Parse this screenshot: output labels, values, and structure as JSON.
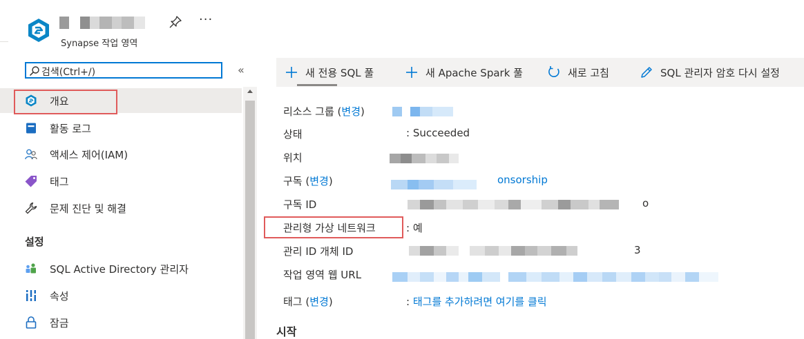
{
  "header": {
    "subtitle": "Synapse 작업 영역",
    "more_label": "···"
  },
  "search": {
    "placeholder": "검색(Ctrl+/)",
    "collapse_label": "«"
  },
  "sidebar": {
    "items": [
      {
        "label": "개요",
        "icon": "synapse-overview-icon"
      },
      {
        "label": "활동 로그",
        "icon": "activity-log-icon"
      },
      {
        "label": "액세스 제어(IAM)",
        "icon": "people-icon"
      },
      {
        "label": "태그",
        "icon": "tag-icon"
      },
      {
        "label": "문제 진단 및 해결",
        "icon": "wrench-icon"
      }
    ],
    "settings_section": "설정",
    "settings_items": [
      {
        "label": "SQL Active Directory 관리자",
        "icon": "sql-ad-admin-icon"
      },
      {
        "label": "속성",
        "icon": "properties-icon"
      },
      {
        "label": "잠금",
        "icon": "lock-icon"
      }
    ]
  },
  "toolbar": {
    "new_sql_pool": "새 전용 SQL 풀",
    "new_spark_pool": "새 Apache Spark 풀",
    "refresh": "새로 고침",
    "reset_sql_password": "SQL 관리자 암호 다시 설정"
  },
  "essentials": {
    "resource_group_label": "리소스 그룹",
    "change_link": "변경",
    "status_label": "상태",
    "status_value": ": Succeeded",
    "location_label": "위치",
    "subscription_label": "구독",
    "subscription_value_tail": "onsorship",
    "subscription_id_label": "구독 ID",
    "subscription_id_tail": "o",
    "managed_vnet_label": "관리형 가상 네트워크",
    "managed_vnet_value": ": 예",
    "managed_identity_label": "관리 ID 개체 ID",
    "managed_identity_tail": "3",
    "workspace_url_label": "작업 영역 웹 URL",
    "tags_label": "태그",
    "tags_value": "태그를 추가하려면 여기를 클릭",
    "tags_colon": ":"
  },
  "start_section": "시작",
  "colors": {
    "accent": "#0078d4",
    "highlight_box": "#e05a5a",
    "selected_bg": "#edebe9",
    "toolbar_bg": "#f3f2f1"
  }
}
